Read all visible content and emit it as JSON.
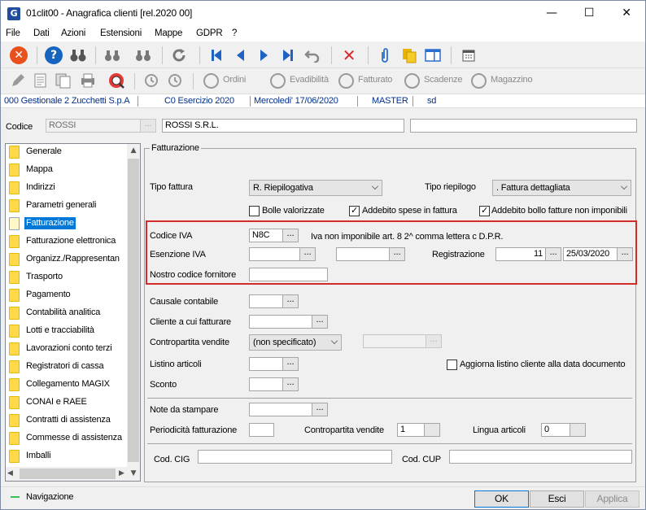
{
  "window": {
    "title": "01clit00 - Anagrafica clienti  [rel.2020 00]",
    "icon_letter": "G"
  },
  "menu": [
    "File",
    "Dati",
    "Azioni",
    "Estensioni",
    "Mappe",
    "GDPR",
    "?"
  ],
  "toolbar2": {
    "ordini": "Ordini",
    "evadibilita": "Evadibilità",
    "fatturato": "Fatturato",
    "scadenze": "Scadenze",
    "magazzino": "Magazzino"
  },
  "status": {
    "company": "000 Gestionale 2 Zucchetti S.p.A",
    "year": "C0 Esercizio 2020",
    "date": "Mercoledi' 17/06/2020",
    "user": "MASTER",
    "code": "sd"
  },
  "header": {
    "codice_label": "Codice",
    "codice_value": "ROSSI",
    "ragione_sociale": "ROSSI S.R.L.",
    "extra": ""
  },
  "nav": [
    "Generale",
    "Mappa",
    "Indirizzi",
    "Parametri generali",
    "Fatturazione",
    "Fatturazione elettronica",
    "Organizz./Rappresentan",
    "Trasporto",
    "Pagamento",
    "Contabilità analitica",
    "Lotti e tracciabilità",
    "Lavorazioni conto terzi",
    "Registratori di cassa",
    "Collegamento MAGIX",
    "CONAI e RAEE",
    "Contratti di assistenza",
    "Commesse di assistenza",
    "Imballi"
  ],
  "selected_nav": "Fatturazione",
  "form": {
    "group_title": "Fatturazione",
    "tipo_fattura_label": "Tipo fattura",
    "tipo_fattura_value": "R. Riepilogativa",
    "tipo_riepilogo_label": "Tipo riepilogo",
    "tipo_riepilogo_value": ". Fattura dettagliata",
    "bolle_valorizzate": "Bolle valorizzate",
    "addebito_spese": "Addebito spese in fattura",
    "addebito_bollo": "Addebito bollo fatture non imponibili",
    "codice_iva_label": "Codice IVA",
    "codice_iva_value": "N8C",
    "codice_iva_desc": "Iva non imponibile art. 8 2^ comma lettera c D.P.R.",
    "esenzione_iva_label": "Esenzione IVA",
    "registrazione_label": "Registrazione",
    "registrazione_num": "11",
    "registrazione_data": "25/03/2020",
    "nostro_codice_label": "Nostro codice fornitore",
    "causale_label": "Causale contabile",
    "cliente_fatturare_label": "Cliente a cui fatturare",
    "contropartita_label": "Contropartita vendite",
    "contropartita_value": "(non specificato)",
    "listino_label": "Listino articoli",
    "aggiorna_listino": "Aggiorna listino cliente alla data documento",
    "sconto_label": "Sconto",
    "note_label": "Note da stampare",
    "periodicita_label": "Periodicità fatturazione",
    "contropartita2_label": "Contropartita vendite",
    "contropartita2_value": "1",
    "lingua_label": "Lingua articoli",
    "lingua_value": "0",
    "cig_label": "Cod. CIG",
    "cup_label": "Cod. CUP"
  },
  "footer": {
    "navigazione": "Navigazione",
    "ok": "OK",
    "esci": "Esci",
    "applica": "Applica"
  },
  "colors": {
    "accent": "#0078d7",
    "highlight_border": "#d32a2a",
    "status_text": "#00308a"
  }
}
